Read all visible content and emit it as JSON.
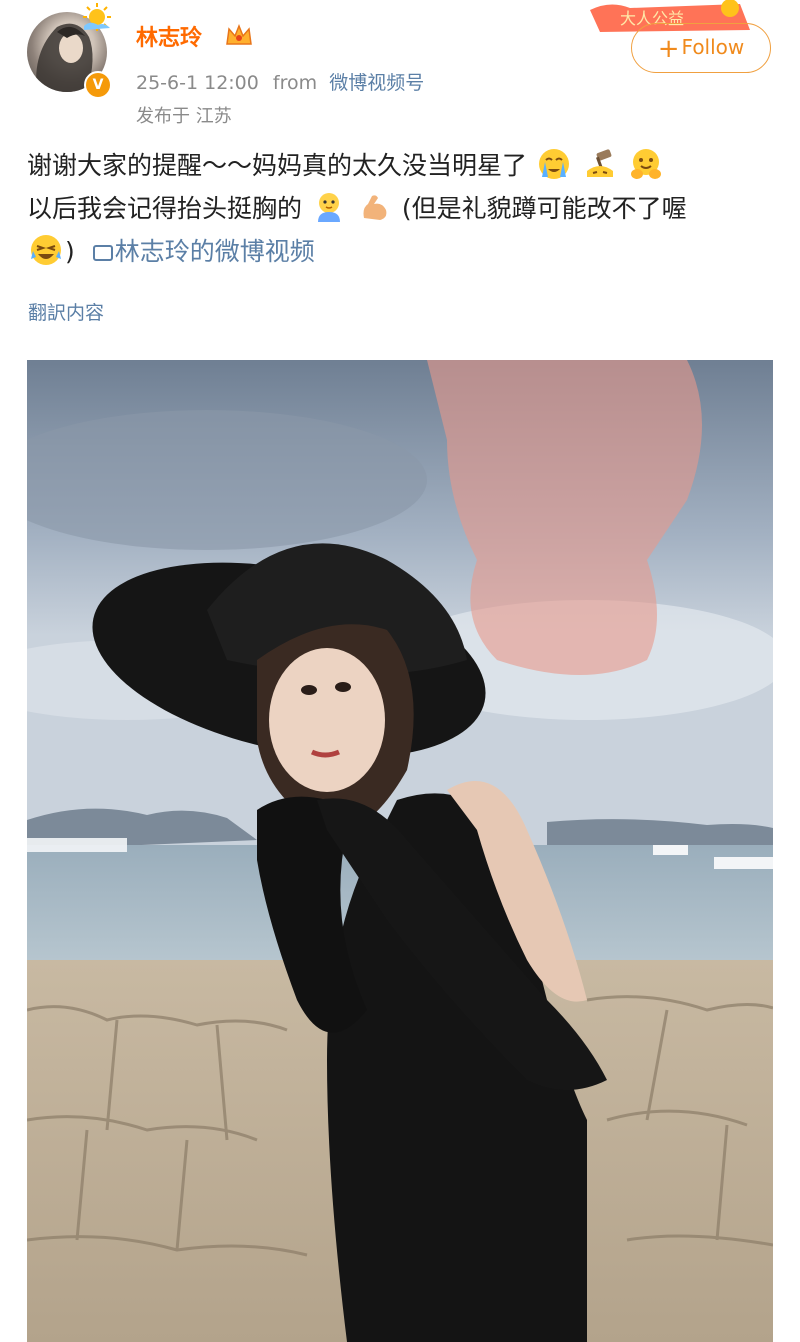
{
  "header": {
    "username": "林志玲",
    "timestamp": "25-6-1 12:00",
    "from_word": "from",
    "source": "微博视频号",
    "location": "发布于 江苏",
    "follow_label": "Follow",
    "promo_text": "大人公益"
  },
  "post": {
    "line1": "谢谢大家的提醒～～妈妈真的太久没当明星了",
    "line2_a": "以后我会记得抬头挺胸的",
    "line2_b": "(但是礼貌蹲可能改不了喔",
    "line3_a": ")",
    "video_link": "林志玲的微博视频",
    "translate": "翻訳内容"
  },
  "colors": {
    "username": "#ff6a00",
    "link": "#5b7fa6",
    "follow": "#f08a1c",
    "meta": "#8a8a8a"
  },
  "icons": [
    "sun-icon",
    "crown-icon",
    "verified-v-icon",
    "plus-icon",
    "crying-emoji",
    "gavel-emoji",
    "hug-emoji",
    "baby-emoji",
    "muscle-emoji",
    "laughing-emoji",
    "video-icon"
  ]
}
